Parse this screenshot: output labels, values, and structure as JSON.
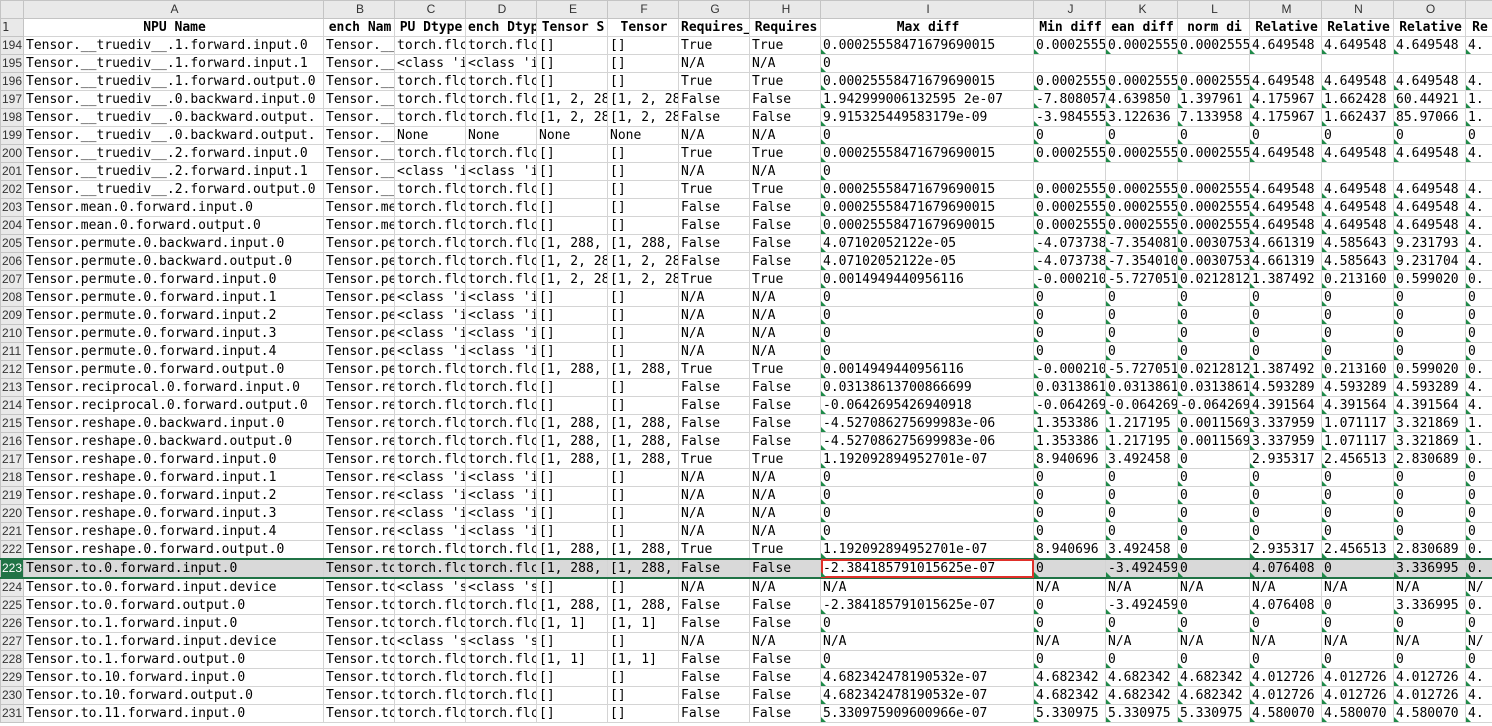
{
  "columns": [
    "A",
    "B",
    "C",
    "D",
    "E",
    "F",
    "G",
    "H",
    "I",
    "J",
    "K",
    "L",
    "M",
    "N",
    "O",
    ""
  ],
  "header_row": {
    "num": "1",
    "cells": [
      "NPU Name",
      "ench Nam",
      "PU Dtype",
      "ench Dtyp",
      "Tensor S",
      "Tensor",
      "Requires_",
      "Requires",
      "Max diff",
      "Min diff",
      "ean diff",
      "norm di",
      "Relative",
      "Relative",
      "Relative",
      "Re"
    ]
  },
  "selected_row_num": "223",
  "active_cell": {
    "row_num": "223",
    "col_index": 8
  },
  "rows": [
    {
      "num": "194",
      "cells": [
        "Tensor.__truediv__.1.forward.input.0",
        "Tensor.__",
        "torch.flc",
        "torch.flc",
        "[]",
        "[]",
        "True",
        "True",
        "0.00025558471679690015",
        "0.0002555",
        "0.0002555",
        "0.0002555",
        "4.649548",
        "4.649548",
        "4.649548",
        "4."
      ]
    },
    {
      "num": "195",
      "cells": [
        "Tensor.__truediv__.1.forward.input.1",
        "Tensor.__",
        "<class 'i",
        "<class 'i",
        "[]",
        "[]",
        "N/A",
        "N/A",
        "0",
        "",
        "",
        "",
        "",
        "",
        "",
        ""
      ]
    },
    {
      "num": "196",
      "cells": [
        "Tensor.__truediv__.1.forward.output.0",
        "Tensor.__",
        "torch.flc",
        "torch.flc",
        "[]",
        "[]",
        "True",
        "True",
        "0.00025558471679690015",
        "0.0002555",
        "0.0002555",
        "0.0002555",
        "4.649548",
        "4.649548",
        "4.649548",
        "4."
      ]
    },
    {
      "num": "197",
      "cells": [
        "Tensor.__truediv__.0.backward.input.0",
        "Tensor.__",
        "torch.flc",
        "torch.flc",
        "[1, 2, 28",
        "[1, 2, 28",
        "False",
        "False",
        "1.942999006132595 2e-07",
        "-7.808057",
        "4.639850",
        "1.397961",
        "4.175967",
        "1.662428",
        "60.44921",
        "1."
      ]
    },
    {
      "num": "198",
      "cells": [
        "Tensor.__truediv__.0.backward.output.",
        "Tensor.__",
        "torch.flc",
        "torch.flc",
        "[1, 2, 28",
        "[1, 2, 28",
        "False",
        "False",
        "9.915325449583179e-09",
        "-3.984555",
        "3.122636",
        "7.133958",
        "4.175967",
        "1.662437",
        "85.97066",
        "1."
      ]
    },
    {
      "num": "199",
      "cells": [
        "Tensor.__truediv__.0.backward.output.",
        "Tensor.__",
        "None",
        "None",
        "None",
        "None",
        "N/A",
        "N/A",
        "0",
        "0",
        "0",
        "0",
        "0",
        "0",
        "0",
        "0"
      ]
    },
    {
      "num": "200",
      "cells": [
        "Tensor.__truediv__.2.forward.input.0",
        "Tensor.__",
        "torch.flc",
        "torch.flc",
        "[]",
        "[]",
        "True",
        "True",
        "0.00025558471679690015",
        "0.0002555",
        "0.0002555",
        "0.0002555",
        "4.649548",
        "4.649548",
        "4.649548",
        "4."
      ]
    },
    {
      "num": "201",
      "cells": [
        "Tensor.__truediv__.2.forward.input.1",
        "Tensor.__",
        "<class 'i",
        "<class 'i",
        "[]",
        "[]",
        "N/A",
        "N/A",
        "0",
        "",
        "",
        "",
        "",
        "",
        "",
        ""
      ]
    },
    {
      "num": "202",
      "cells": [
        "Tensor.__truediv__.2.forward.output.0",
        "Tensor.__",
        "torch.flc",
        "torch.flc",
        "[]",
        "[]",
        "True",
        "True",
        "0.00025558471679690015",
        "0.0002555",
        "0.0002555",
        "0.0002555",
        "4.649548",
        "4.649548",
        "4.649548",
        "4."
      ]
    },
    {
      "num": "203",
      "cells": [
        "Tensor.mean.0.forward.input.0",
        "Tensor.me",
        "torch.flc",
        "torch.flc",
        "[]",
        "[]",
        "False",
        "False",
        "0.00025558471679690015",
        "0.0002555",
        "0.0002555",
        "0.0002555",
        "4.649548",
        "4.649548",
        "4.649548",
        "4."
      ]
    },
    {
      "num": "204",
      "cells": [
        "Tensor.mean.0.forward.output.0",
        "Tensor.me",
        "torch.flc",
        "torch.flc",
        "[]",
        "[]",
        "False",
        "False",
        "0.00025558471679690015",
        "0.0002555",
        "0.0002555",
        "0.0002555",
        "4.649548",
        "4.649548",
        "4.649548",
        "4."
      ]
    },
    {
      "num": "205",
      "cells": [
        "Tensor.permute.0.backward.input.0",
        "Tensor.pe",
        "torch.flc",
        "torch.flc",
        "[1, 288,",
        "[1, 288,",
        "False",
        "False",
        "4.07102052122e-05",
        "-4.073738",
        "-7.354081",
        "0.0030753",
        "4.661319",
        "4.585643",
        "9.231793",
        "4."
      ]
    },
    {
      "num": "206",
      "cells": [
        "Tensor.permute.0.backward.output.0",
        "Tensor.pe",
        "torch.flc",
        "torch.flc",
        "[1, 2, 28",
        "[1, 2, 28",
        "False",
        "False",
        "4.07102052122e-05",
        "-4.073738",
        "-7.354010",
        "0.0030753",
        "4.661319",
        "4.585643",
        "9.231704",
        "4."
      ]
    },
    {
      "num": "207",
      "cells": [
        "Tensor.permute.0.forward.input.0",
        "Tensor.pe",
        "torch.flc",
        "torch.flc",
        "[1, 2, 28",
        "[1, 2, 28",
        "True",
        "True",
        "0.0014949440956116",
        "-0.000210",
        "-5.727051",
        "0.0212812",
        "1.387492",
        "0.213160",
        "0.599020",
        "0."
      ]
    },
    {
      "num": "208",
      "cells": [
        "Tensor.permute.0.forward.input.1",
        "Tensor.pe",
        "<class 'i",
        "<class 'i",
        "[]",
        "[]",
        "N/A",
        "N/A",
        "0",
        "0",
        "0",
        "0",
        "0",
        "0",
        "0",
        "0"
      ]
    },
    {
      "num": "209",
      "cells": [
        "Tensor.permute.0.forward.input.2",
        "Tensor.pe",
        "<class 'i",
        "<class 'i",
        "[]",
        "[]",
        "N/A",
        "N/A",
        "0",
        "0",
        "0",
        "0",
        "0",
        "0",
        "0",
        "0"
      ]
    },
    {
      "num": "210",
      "cells": [
        "Tensor.permute.0.forward.input.3",
        "Tensor.pe",
        "<class 'i",
        "<class 'i",
        "[]",
        "[]",
        "N/A",
        "N/A",
        "0",
        "0",
        "0",
        "0",
        "0",
        "0",
        "0",
        "0"
      ]
    },
    {
      "num": "211",
      "cells": [
        "Tensor.permute.0.forward.input.4",
        "Tensor.pe",
        "<class 'i",
        "<class 'i",
        "[]",
        "[]",
        "N/A",
        "N/A",
        "0",
        "0",
        "0",
        "0",
        "0",
        "0",
        "0",
        "0"
      ]
    },
    {
      "num": "212",
      "cells": [
        "Tensor.permute.0.forward.output.0",
        "Tensor.pe",
        "torch.flc",
        "torch.flc",
        "[1, 288,",
        "[1, 288,",
        "True",
        "True",
        "0.0014949440956116",
        "-0.000210",
        "-5.727051",
        "0.0212812",
        "1.387492",
        "0.213160",
        "0.599020",
        "0."
      ]
    },
    {
      "num": "213",
      "cells": [
        "Tensor.reciprocal.0.forward.input.0",
        "Tensor.re",
        "torch.flc",
        "torch.flc",
        "[]",
        "[]",
        "False",
        "False",
        "0.03138613700866699",
        "0.0313861",
        "0.0313861",
        "0.0313861",
        "4.593289",
        "4.593289",
        "4.593289",
        "4."
      ]
    },
    {
      "num": "214",
      "cells": [
        "Tensor.reciprocal.0.forward.output.0",
        "Tensor.re",
        "torch.flc",
        "torch.flc",
        "[]",
        "[]",
        "False",
        "False",
        "-0.0642695426940918",
        "-0.064269",
        "-0.064269",
        "-0.064269",
        "4.391564",
        "4.391564",
        "4.391564",
        "4."
      ]
    },
    {
      "num": "215",
      "cells": [
        "Tensor.reshape.0.backward.input.0",
        "Tensor.re",
        "torch.flc",
        "torch.flc",
        "[1, 288,",
        "[1, 288,",
        "False",
        "False",
        "-4.527086275699983e-06",
        "1.353386",
        "1.217195",
        "0.0011569",
        "3.337959",
        "1.071117",
        "3.321869",
        "1."
      ]
    },
    {
      "num": "216",
      "cells": [
        "Tensor.reshape.0.backward.output.0",
        "Tensor.re",
        "torch.flc",
        "torch.flc",
        "[1, 288,",
        "[1, 288,",
        "False",
        "False",
        "-4.527086275699983e-06",
        "1.353386",
        "1.217195",
        "0.0011569",
        "3.337959",
        "1.071117",
        "3.321869",
        "1."
      ]
    },
    {
      "num": "217",
      "cells": [
        "Tensor.reshape.0.forward.input.0",
        "Tensor.re",
        "torch.flc",
        "torch.flc",
        "[1, 288,",
        "[1, 288,",
        "True",
        "True",
        "1.192092894952701e-07",
        "8.940696",
        "3.492458",
        "0",
        "2.935317",
        "2.456513",
        "2.830689",
        "0."
      ]
    },
    {
      "num": "218",
      "cells": [
        "Tensor.reshape.0.forward.input.1",
        "Tensor.re",
        "<class 'i",
        "<class 'i",
        "[]",
        "[]",
        "N/A",
        "N/A",
        "0",
        "0",
        "0",
        "0",
        "0",
        "0",
        "0",
        "0"
      ]
    },
    {
      "num": "219",
      "cells": [
        "Tensor.reshape.0.forward.input.2",
        "Tensor.re",
        "<class 'i",
        "<class 'i",
        "[]",
        "[]",
        "N/A",
        "N/A",
        "0",
        "0",
        "0",
        "0",
        "0",
        "0",
        "0",
        "0"
      ]
    },
    {
      "num": "220",
      "cells": [
        "Tensor.reshape.0.forward.input.3",
        "Tensor.re",
        "<class 'i",
        "<class 'i",
        "[]",
        "[]",
        "N/A",
        "N/A",
        "0",
        "0",
        "0",
        "0",
        "0",
        "0",
        "0",
        "0"
      ]
    },
    {
      "num": "221",
      "cells": [
        "Tensor.reshape.0.forward.input.4",
        "Tensor.re",
        "<class 'i",
        "<class 'i",
        "[]",
        "[]",
        "N/A",
        "N/A",
        "0",
        "0",
        "0",
        "0",
        "0",
        "0",
        "0",
        "0"
      ]
    },
    {
      "num": "222",
      "cells": [
        "Tensor.reshape.0.forward.output.0",
        "Tensor.re",
        "torch.flc",
        "torch.flc",
        "[1, 288,",
        "[1, 288,",
        "True",
        "True",
        "1.192092894952701e-07",
        "8.940696",
        "3.492458",
        "0",
        "2.935317",
        "2.456513",
        "2.830689",
        "0."
      ]
    },
    {
      "num": "223",
      "cells": [
        "Tensor.to.0.forward.input.0",
        "Tensor.tc",
        "torch.flc",
        "torch.flc",
        "[1, 288,",
        "[1, 288,",
        "False",
        "False",
        "-2.384185791015625e-07",
        "0",
        "-3.492459",
        "0",
        "4.076408",
        "0",
        "3.336995",
        "0."
      ]
    },
    {
      "num": "224",
      "cells": [
        "Tensor.to.0.forward.input.device",
        "Tensor.tc",
        "<class 's",
        "<class 's",
        "[]",
        "[]",
        "N/A",
        "N/A",
        "N/A",
        "N/A",
        "N/A",
        "N/A",
        "N/A",
        "N/A",
        "N/A",
        "N/"
      ]
    },
    {
      "num": "225",
      "cells": [
        "Tensor.to.0.forward.output.0",
        "Tensor.tc",
        "torch.flc",
        "torch.flc",
        "[1, 288,",
        "[1, 288,",
        "False",
        "False",
        "-2.384185791015625e-07",
        "0",
        "-3.492459",
        "0",
        "4.076408",
        "0",
        "3.336995",
        "0."
      ]
    },
    {
      "num": "226",
      "cells": [
        "Tensor.to.1.forward.input.0",
        "Tensor.tc",
        "torch.flc",
        "torch.flc",
        "[1, 1]",
        "[1, 1]",
        "False",
        "False",
        "0",
        "0",
        "0",
        "0",
        "0",
        "0",
        "0",
        "0"
      ]
    },
    {
      "num": "227",
      "cells": [
        "Tensor.to.1.forward.input.device",
        "Tensor.tc",
        "<class 's",
        "<class 's",
        "[]",
        "[]",
        "N/A",
        "N/A",
        "N/A",
        "N/A",
        "N/A",
        "N/A",
        "N/A",
        "N/A",
        "N/A",
        "N/"
      ]
    },
    {
      "num": "228",
      "cells": [
        "Tensor.to.1.forward.output.0",
        "Tensor.tc",
        "torch.flc",
        "torch.flc",
        "[1, 1]",
        "[1, 1]",
        "False",
        "False",
        "0",
        "0",
        "0",
        "0",
        "0",
        "0",
        "0",
        "0"
      ]
    },
    {
      "num": "229",
      "cells": [
        "Tensor.to.10.forward.input.0",
        "Tensor.tc",
        "torch.flc",
        "torch.flc",
        "[]",
        "[]",
        "False",
        "False",
        "4.682342478190532e-07",
        "4.682342",
        "4.682342",
        "4.682342",
        "4.012726",
        "4.012726",
        "4.012726",
        "4."
      ]
    },
    {
      "num": "230",
      "cells": [
        "Tensor.to.10.forward.output.0",
        "Tensor.tc",
        "torch.flc",
        "torch.flc",
        "[]",
        "[]",
        "False",
        "False",
        "4.682342478190532e-07",
        "4.682342",
        "4.682342",
        "4.682342",
        "4.012726",
        "4.012726",
        "4.012726",
        "4."
      ]
    },
    {
      "num": "231",
      "cells": [
        "Tensor.to.11.forward.input.0",
        "Tensor.tc",
        "torch.flc",
        "torch.flc",
        "[]",
        "[]",
        "False",
        "False",
        "5.330975909600966e-07",
        "5.330975",
        "5.330975",
        "5.330975",
        "4.580070",
        "4.580070",
        "4.580070",
        "4."
      ]
    }
  ]
}
